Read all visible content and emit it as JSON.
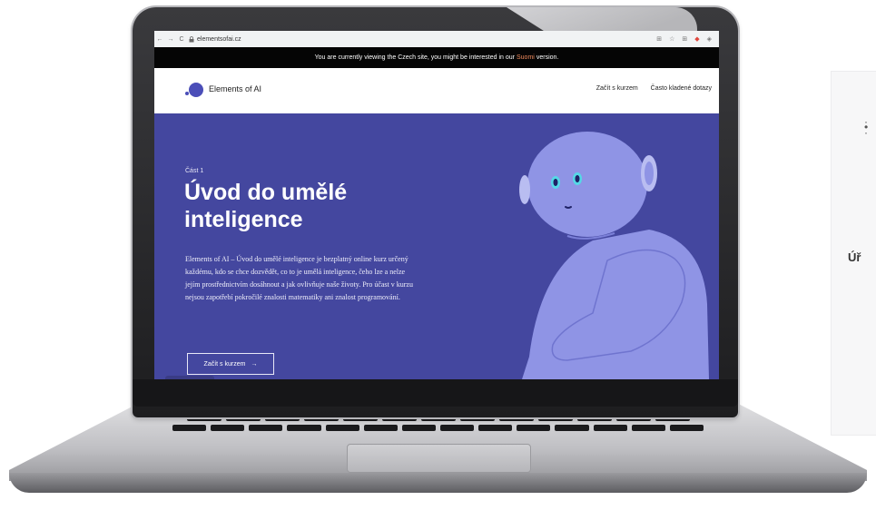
{
  "browser": {
    "url": "elementsofai.cz",
    "nav": {
      "back": "←",
      "forward": "→",
      "reload": "C"
    }
  },
  "notice": {
    "before": "You are currently viewing the Czech site, you might be interested in our",
    "link": "Suomi",
    "after": "version."
  },
  "site": {
    "brand": "Elements of AI",
    "nav": [
      "Začít s kurzem",
      "Často kladené dotazy"
    ]
  },
  "hero": {
    "part": "Část 1",
    "title": "Úvod do umělé inteligence",
    "description": "Elements of AI – Úvod do umělé inteligence je bezplatný online kurz určený každému, kdo se chce dozvědět, co to je umělá inteligence, čeho lze a nelze jejím prostřednictvím dosáhnout a jak ovlivňuje naše životy. Pro účast v kurzu nejsou zapotřebí pokročilé znalosti matematiky ani znalost programování.",
    "cta": "Začít s kurzem",
    "cta_arrow": "→"
  },
  "side_panel": {
    "text": "Úř"
  },
  "colors": {
    "hero_bg": "#44479f",
    "robot": "#8f94e5",
    "robot_shadow": "#7b80d8",
    "eye": "#55d8e6",
    "notice_link": "#f08a5d",
    "logo": "#4b4eb8"
  },
  "icons": {
    "lock": "lock-icon",
    "star": "star-icon",
    "extension": "extension-icon"
  }
}
